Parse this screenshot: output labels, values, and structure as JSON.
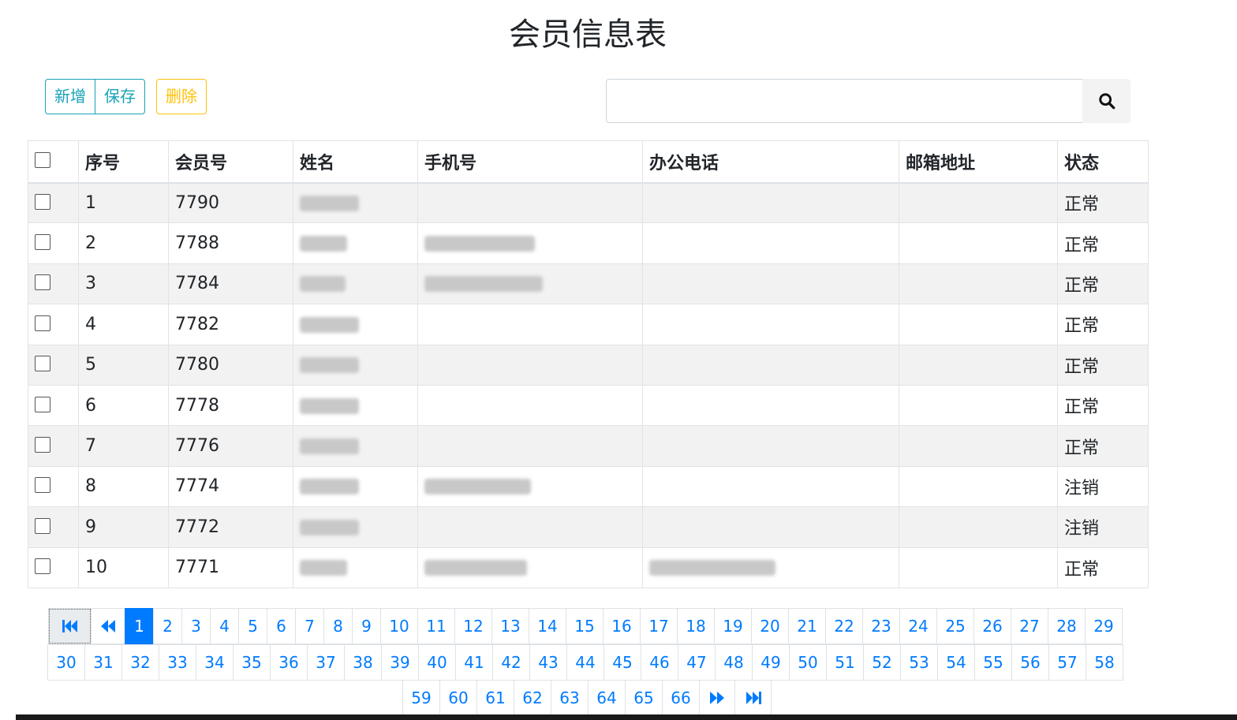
{
  "page": {
    "title": "会员信息表"
  },
  "toolbar": {
    "add_label": "新增",
    "save_label": "保存",
    "delete_label": "删除"
  },
  "search": {
    "placeholder": "",
    "value": ""
  },
  "table": {
    "headers": [
      "序号",
      "会员号",
      "姓名",
      "手机号",
      "办公电话",
      "邮箱地址",
      "状态"
    ],
    "rows": [
      {
        "index": "1",
        "member_no": "7790",
        "status": "正常"
      },
      {
        "index": "2",
        "member_no": "7788",
        "status": "正常"
      },
      {
        "index": "3",
        "member_no": "7784",
        "status": "正常"
      },
      {
        "index": "4",
        "member_no": "7782",
        "status": "正常"
      },
      {
        "index": "5",
        "member_no": "7780",
        "status": "正常"
      },
      {
        "index": "6",
        "member_no": "7778",
        "status": "正常"
      },
      {
        "index": "7",
        "member_no": "7776",
        "status": "正常"
      },
      {
        "index": "8",
        "member_no": "7774",
        "status": "注销"
      },
      {
        "index": "9",
        "member_no": "7772",
        "status": "注销"
      },
      {
        "index": "10",
        "member_no": "7771",
        "status": "正常"
      }
    ]
  },
  "pagination": {
    "current": 1,
    "row1": [
      "1",
      "2",
      "3",
      "4",
      "5",
      "6",
      "7",
      "8",
      "9",
      "10",
      "11",
      "12",
      "13",
      "14",
      "15",
      "16",
      "17",
      "18",
      "19",
      "20",
      "21",
      "22",
      "23",
      "24",
      "25",
      "26",
      "27",
      "28",
      "29"
    ],
    "row2": [
      "30",
      "31",
      "32",
      "33",
      "34",
      "35",
      "36",
      "37",
      "38",
      "39",
      "40",
      "41",
      "42",
      "43",
      "44",
      "45",
      "46",
      "47",
      "48",
      "49",
      "50",
      "51",
      "52",
      "53",
      "54",
      "55",
      "56",
      "57",
      "58"
    ],
    "row3": [
      "59",
      "60",
      "61",
      "62",
      "63",
      "64",
      "65",
      "66"
    ]
  },
  "colors": {
    "primary": "#007bff",
    "info": "#17a2b8",
    "warning": "#ffc107"
  }
}
